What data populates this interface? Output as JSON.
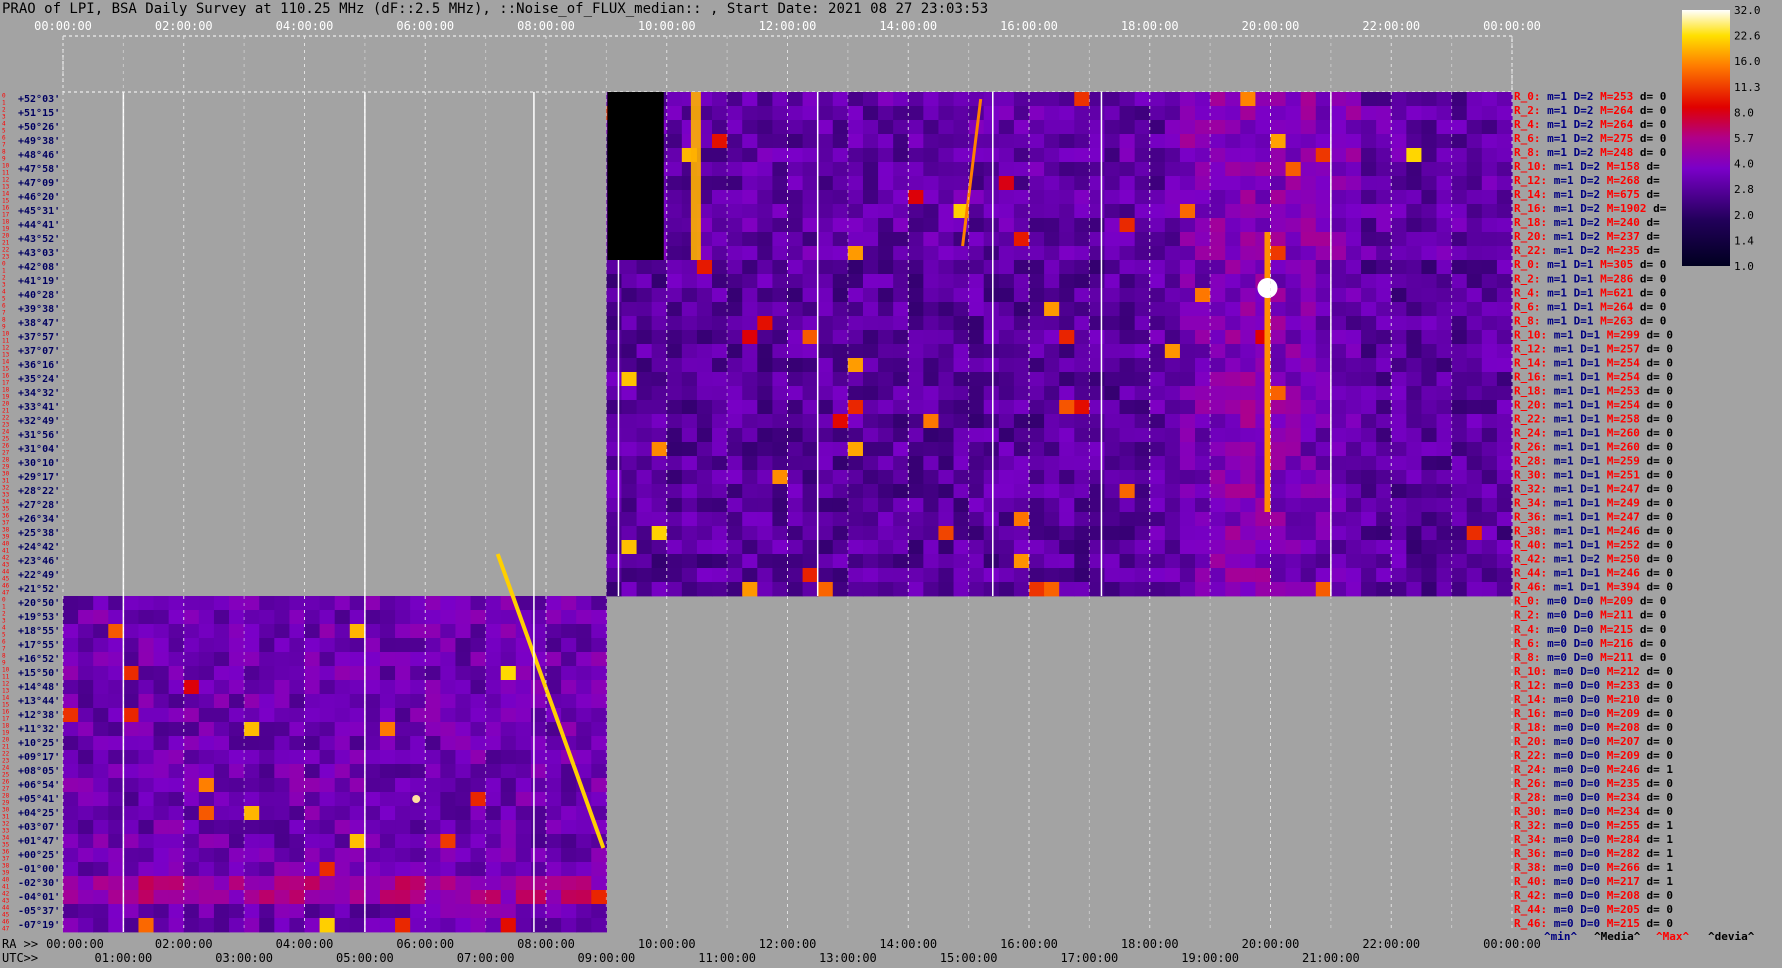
{
  "title": "PRAO of LPI, BSA Daily Survey at 110.25 MHz (dF::2.5 MHz), ::Noise_of_FLUX_median:: , Start Date: 2021 08 27 23:03:53",
  "axis_labels": {
    "ra": "RA >>",
    "utc": "UTC>>"
  },
  "colorbar_ticks": [
    "32.0",
    "22.6",
    "16.0",
    "11.3",
    "8.0",
    "5.7",
    "4.0",
    "2.8",
    "2.0",
    "1.4",
    "1.0"
  ],
  "footer_legend": [
    "^min^",
    "^Media^",
    "^Max^",
    "^devia^"
  ],
  "colors": {
    "background": "#a3a3a3",
    "label_red": "#ff0000",
    "label_navy": "#000080",
    "dec_blue": "#000060"
  },
  "chart_data": {
    "type": "heatmap",
    "title": "PRAO of LPI, BSA Daily Survey at 110.25 MHz (dF::2.5 MHz), ::Noise_of_FLUX_median:: , Start Date: 2021 08 27 23:03:53",
    "top_ticks": [
      "00:00:00",
      "02:00:00",
      "04:00:00",
      "06:00:00",
      "08:00:00",
      "10:00:00",
      "12:00:00",
      "14:00:00",
      "16:00:00",
      "18:00:00",
      "20:00:00",
      "22:00:00",
      "00:00:00"
    ],
    "bottom_ra_ticks": [
      "00:00:00",
      "02:00:00",
      "04:00:00",
      "06:00:00",
      "08:00:00",
      "10:00:00",
      "12:00:00",
      "14:00:00",
      "16:00:00",
      "18:00:00",
      "20:00:00",
      "22:00:00",
      "00:00:00"
    ],
    "bottom_utc_ticks": [
      "01:00:00",
      "03:00:00",
      "05:00:00",
      "07:00:00",
      "09:00:00",
      "11:00:00",
      "13:00:00",
      "15:00:00",
      "17:00:00",
      "19:00:00",
      "21:00:00"
    ],
    "declinations": [
      "+52°03'",
      "+51°15'",
      "+50°26'",
      "+49°38'",
      "+48°46'",
      "+47°58'",
      "+47°09'",
      "+46°20'",
      "+45°31'",
      "+44°41'",
      "+43°52'",
      "+43°03'",
      "+42°08'",
      "+41°19'",
      "+40°28'",
      "+39°38'",
      "+38°47'",
      "+37°57'",
      "+37°07'",
      "+36°16'",
      "+35°24'",
      "+34°32'",
      "+33°41'",
      "+32°49'",
      "+31°56'",
      "+31°04'",
      "+30°10'",
      "+29°17'",
      "+28°22'",
      "+27°28'",
      "+26°34'",
      "+25°38'",
      "+24°42'",
      "+23°46'",
      "+22°49'",
      "+21°52'",
      "+20°50'",
      "+19°53'",
      "+18°55'",
      "+17°55'",
      "+16°52'",
      "+15°50'",
      "+14°48'",
      "+13°44'",
      "+12°38'",
      "+11°32'",
      "+10°25'",
      "+09°17'",
      "+08°05'",
      "+06°54'",
      "+05°41'",
      "+04°25'",
      "+03°07'",
      "+01°47'",
      "+00°25'",
      "-01°00'",
      "-02°30'",
      "-04°01'",
      "-05°37'",
      "-07°19'"
    ],
    "row_numbers": [
      "0",
      "1",
      "2",
      "3",
      "4",
      "5",
      "6",
      "7",
      "8",
      "9",
      "10",
      "11",
      "12",
      "13",
      "14",
      "15",
      "16",
      "17",
      "18",
      "19",
      "20",
      "21",
      "22",
      "23",
      "0",
      "1",
      "2",
      "3",
      "4",
      "5",
      "6",
      "7",
      "8",
      "9",
      "10",
      "11",
      "12",
      "13",
      "14",
      "15",
      "16",
      "17",
      "18",
      "19",
      "20",
      "21",
      "22",
      "23",
      "24",
      "25",
      "26",
      "27",
      "28",
      "29",
      "30",
      "31",
      "32",
      "33",
      "34",
      "35",
      "36",
      "37",
      "38",
      "39",
      "40",
      "41",
      "42",
      "43",
      "44",
      "45",
      "46",
      "47",
      "0",
      "1",
      "2",
      "3",
      "4",
      "5",
      "6",
      "7",
      "8",
      "9",
      "10",
      "11",
      "12",
      "13",
      "14",
      "15",
      "16",
      "17",
      "18",
      "19",
      "20",
      "21",
      "22",
      "23",
      "24",
      "25",
      "26",
      "27",
      "28",
      "29",
      "30",
      "31",
      "32",
      "33",
      "34",
      "35",
      "36",
      "37",
      "38",
      "39",
      "40",
      "41",
      "42",
      "43",
      "44",
      "45",
      "46",
      "47"
    ],
    "colorbar": {
      "min": 1.0,
      "max": 32.0,
      "scale": "log",
      "colormap": "gnuplot-like"
    },
    "data_coverage": [
      {
        "rows": "0-23",
        "ra_start": "09:00:00",
        "ra_end": "00:00:00"
      },
      {
        "rows": "24-71",
        "ra_start": "09:00:00",
        "ra_end": "00:00:00"
      },
      {
        "rows": "72-119",
        "ra_start": "00:00:00",
        "ra_end": "09:00:00"
      }
    ],
    "grid": true,
    "ra_labels": [
      {
        "r": "R_0:",
        "m": "m=1",
        "d": "D=2",
        "M": "M=253",
        "dv": "d= 0"
      },
      {
        "r": "R_2:",
        "m": "m=1",
        "d": "D=2",
        "M": "M=264",
        "dv": "d= 0"
      },
      {
        "r": "R_4:",
        "m": "m=1",
        "d": "D=2",
        "M": "M=264",
        "dv": "d= 0"
      },
      {
        "r": "R_6:",
        "m": "m=1",
        "d": "D=2",
        "M": "M=275",
        "dv": "d= 0"
      },
      {
        "r": "R_8:",
        "m": "m=1",
        "d": "D=2",
        "M": "M=248",
        "dv": "d= 0"
      },
      {
        "r": "R_10:",
        "m": "m=1",
        "d": "D=2",
        "M": "M=158",
        "dv": "d="
      },
      {
        "r": "R_12:",
        "m": "m=1",
        "d": "D=2",
        "M": "M=268",
        "dv": "d="
      },
      {
        "r": "R_14:",
        "m": "m=1",
        "d": "D=2",
        "M": "M=675",
        "dv": "d="
      },
      {
        "r": "R_16:",
        "m": "m=1",
        "d": "D=2",
        "M": "M=1902",
        "dv": "d="
      },
      {
        "r": "R_18:",
        "m": "m=1",
        "d": "D=2",
        "M": "M=240",
        "dv": "d="
      },
      {
        "r": "R_20:",
        "m": "m=1",
        "d": "D=2",
        "M": "M=237",
        "dv": "d="
      },
      {
        "r": "R_22:",
        "m": "m=1",
        "d": "D=2",
        "M": "M=235",
        "dv": "d="
      },
      {
        "r": "R_0:",
        "m": "m=1",
        "d": "D=1",
        "M": "M=305",
        "dv": "d= 0"
      },
      {
        "r": "R_2:",
        "m": "m=1",
        "d": "D=1",
        "M": "M=286",
        "dv": "d= 0"
      },
      {
        "r": "R_4:",
        "m": "m=1",
        "d": "D=1",
        "M": "M=621",
        "dv": "d= 0"
      },
      {
        "r": "R_6:",
        "m": "m=1",
        "d": "D=1",
        "M": "M=264",
        "dv": "d= 0"
      },
      {
        "r": "R_8:",
        "m": "m=1",
        "d": "D=1",
        "M": "M=263",
        "dv": "d= 0"
      },
      {
        "r": "R_10:",
        "m": "m=1",
        "d": "D=1",
        "M": "M=299",
        "dv": "d= 0"
      },
      {
        "r": "R_12:",
        "m": "m=1",
        "d": "D=1",
        "M": "M=257",
        "dv": "d= 0"
      },
      {
        "r": "R_14:",
        "m": "m=1",
        "d": "D=1",
        "M": "M=254",
        "dv": "d= 0"
      },
      {
        "r": "R_16:",
        "m": "m=1",
        "d": "D=1",
        "M": "M=254",
        "dv": "d= 0"
      },
      {
        "r": "R_18:",
        "m": "m=1",
        "d": "D=1",
        "M": "M=253",
        "dv": "d= 0"
      },
      {
        "r": "R_20:",
        "m": "m=1",
        "d": "D=1",
        "M": "M=254",
        "dv": "d= 0"
      },
      {
        "r": "R_22:",
        "m": "m=1",
        "d": "D=1",
        "M": "M=258",
        "dv": "d= 0"
      },
      {
        "r": "R_24:",
        "m": "m=1",
        "d": "D=1",
        "M": "M=260",
        "dv": "d= 0"
      },
      {
        "r": "R_26:",
        "m": "m=1",
        "d": "D=1",
        "M": "M=260",
        "dv": "d= 0"
      },
      {
        "r": "R_28:",
        "m": "m=1",
        "d": "D=1",
        "M": "M=259",
        "dv": "d= 0"
      },
      {
        "r": "R_30:",
        "m": "m=1",
        "d": "D=1",
        "M": "M=251",
        "dv": "d= 0"
      },
      {
        "r": "R_32:",
        "m": "m=1",
        "d": "D=1",
        "M": "M=247",
        "dv": "d= 0"
      },
      {
        "r": "R_34:",
        "m": "m=1",
        "d": "D=1",
        "M": "M=249",
        "dv": "d= 0"
      },
      {
        "r": "R_36:",
        "m": "m=1",
        "d": "D=1",
        "M": "M=247",
        "dv": "d= 0"
      },
      {
        "r": "R_38:",
        "m": "m=1",
        "d": "D=1",
        "M": "M=246",
        "dv": "d= 0"
      },
      {
        "r": "R_40:",
        "m": "m=1",
        "d": "D=1",
        "M": "M=252",
        "dv": "d= 0"
      },
      {
        "r": "R_42:",
        "m": "m=1",
        "d": "D=2",
        "M": "M=250",
        "dv": "d= 0"
      },
      {
        "r": "R_44:",
        "m": "m=1",
        "d": "D=1",
        "M": "M=246",
        "dv": "d= 0"
      },
      {
        "r": "R_46:",
        "m": "m=1",
        "d": "D=1",
        "M": "M=394",
        "dv": "d= 0"
      },
      {
        "r": "R_0:",
        "m": "m=0",
        "d": "D=0",
        "M": "M=209",
        "dv": "d= 0"
      },
      {
        "r": "R_2:",
        "m": "m=0",
        "d": "D=0",
        "M": "M=211",
        "dv": "d= 0"
      },
      {
        "r": "R_4:",
        "m": "m=0",
        "d": "D=0",
        "M": "M=215",
        "dv": "d= 0"
      },
      {
        "r": "R_6:",
        "m": "m=0",
        "d": "D=0",
        "M": "M=216",
        "dv": "d= 0"
      },
      {
        "r": "R_8:",
        "m": "m=0",
        "d": "D=0",
        "M": "M=211",
        "dv": "d= 0"
      },
      {
        "r": "R_10:",
        "m": "m=0",
        "d": "D=0",
        "M": "M=212",
        "dv": "d= 0"
      },
      {
        "r": "R_12:",
        "m": "m=0",
        "d": "D=0",
        "M": "M=233",
        "dv": "d= 0"
      },
      {
        "r": "R_14:",
        "m": "m=0",
        "d": "D=0",
        "M": "M=210",
        "dv": "d= 0"
      },
      {
        "r": "R_16:",
        "m": "m=0",
        "d": "D=0",
        "M": "M=209",
        "dv": "d= 0"
      },
      {
        "r": "R_18:",
        "m": "m=0",
        "d": "D=0",
        "M": "M=208",
        "dv": "d= 0"
      },
      {
        "r": "R_20:",
        "m": "m=0",
        "d": "D=0",
        "M": "M=207",
        "dv": "d= 0"
      },
      {
        "r": "R_22:",
        "m": "m=0",
        "d": "D=0",
        "M": "M=209",
        "dv": "d= 0"
      },
      {
        "r": "R_24:",
        "m": "m=0",
        "d": "D=0",
        "M": "M=246",
        "dv": "d= 1"
      },
      {
        "r": "R_26:",
        "m": "m=0",
        "d": "D=0",
        "M": "M=235",
        "dv": "d= 0"
      },
      {
        "r": "R_28:",
        "m": "m=0",
        "d": "D=0",
        "M": "M=234",
        "dv": "d= 0"
      },
      {
        "r": "R_30:",
        "m": "m=0",
        "d": "D=0",
        "M": "M=234",
        "dv": "d= 0"
      },
      {
        "r": "R_32:",
        "m": "m=0",
        "d": "D=0",
        "M": "M=255",
        "dv": "d= 1"
      },
      {
        "r": "R_34:",
        "m": "m=0",
        "d": "D=0",
        "M": "M=284",
        "dv": "d= 1"
      },
      {
        "r": "R_36:",
        "m": "m=0",
        "d": "D=0",
        "M": "M=282",
        "dv": "d= 1"
      },
      {
        "r": "R_38:",
        "m": "m=0",
        "d": "D=0",
        "M": "M=266",
        "dv": "d= 1"
      },
      {
        "r": "R_40:",
        "m": "m=0",
        "d": "D=0",
        "M": "M=217",
        "dv": "d= 1"
      },
      {
        "r": "R_42:",
        "m": "m=0",
        "d": "D=0",
        "M": "M=208",
        "dv": "d= 0"
      },
      {
        "r": "R_44:",
        "m": "m=0",
        "d": "D=0",
        "M": "M=205",
        "dv": "d= 0"
      },
      {
        "r": "R_46:",
        "m": "m=0",
        "d": "D=0",
        "M": "M=215",
        "dv": "d= 0"
      }
    ]
  }
}
